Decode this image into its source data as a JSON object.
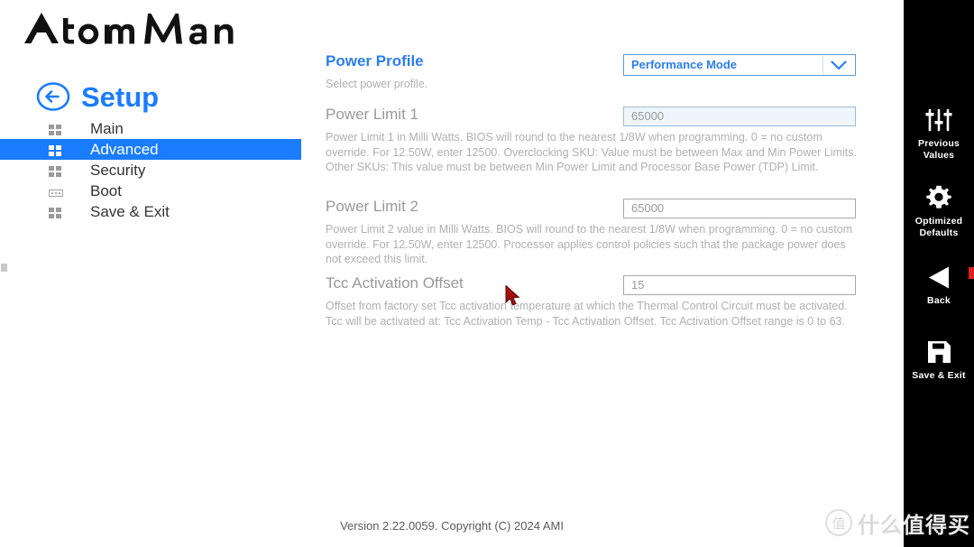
{
  "brand": {
    "logo_text": "AtomMan"
  },
  "setup": {
    "title": "Setup",
    "back_icon": "circle-left-arrow-icon"
  },
  "nav": {
    "items": [
      {
        "label": "Main",
        "icon": "grid-squares-icon",
        "active": false
      },
      {
        "label": "Advanced",
        "icon": "grid-squares-icon",
        "active": true
      },
      {
        "label": "Security",
        "icon": "grid-squares-icon",
        "active": false
      },
      {
        "label": "Boot",
        "icon": "keyboard-icon",
        "active": false
      },
      {
        "label": "Save & Exit",
        "icon": "grid-squares-icon",
        "active": false
      }
    ]
  },
  "form": {
    "fields": [
      {
        "label": "Power Profile",
        "description": "Select power profile.",
        "control": "select",
        "value": "Performance Mode"
      },
      {
        "label": "Power Limit 1",
        "description": "Power Limit 1 in Milli Watts. BIOS will round to the nearest 1/8W when programming. 0 = no custom override. For 12.50W, enter 12500. Overclocking SKU: Value must be between Max and Min Power Limits. Other SKUs: This value must be between Min Power Limit and Processor Base Power (TDP) Limit.",
        "control": "input",
        "value": "65000"
      },
      {
        "label": "Power Limit 2",
        "description": "Power Limit 2 value in Milli Watts. BIOS will round to the nearest 1/8W when programming. 0 = no custom override. For 12.50W, enter 12500. Processor applies control policies such that the package power does not exceed this limit.",
        "control": "input",
        "value": "65000"
      },
      {
        "label": "Tcc Activation Offset",
        "description": "Offset from factory set Tcc activation temperature at which the Thermal Control Circuit must be activated. Tcc will be activated at: Tcc Activation Temp - Tcc Activation Offset. Tcc Activation Offset range is 0 to 63.",
        "control": "input",
        "value": "15"
      }
    ]
  },
  "rightbar": {
    "items": [
      {
        "label": "Previous\nValues",
        "icon": "sliders-icon"
      },
      {
        "label": "Optimized\nDefaults",
        "icon": "gear-icon"
      },
      {
        "label": "Back",
        "icon": "left-triangle-icon"
      },
      {
        "label": "Save & Exit",
        "icon": "floppy-disk-icon"
      }
    ]
  },
  "footer": {
    "version_text": "Version 2.22.0059. Copyright (C) 2024 AMI"
  },
  "watermark": {
    "mark": "值",
    "text_left": "什么",
    "text_right": "值得买"
  },
  "colors": {
    "accent_blue": "#1a7cff",
    "label_gray": "#999999",
    "desc_gray": "#b0b0b0",
    "panel_black": "#000000",
    "cursor_red": "#a40f0f"
  }
}
